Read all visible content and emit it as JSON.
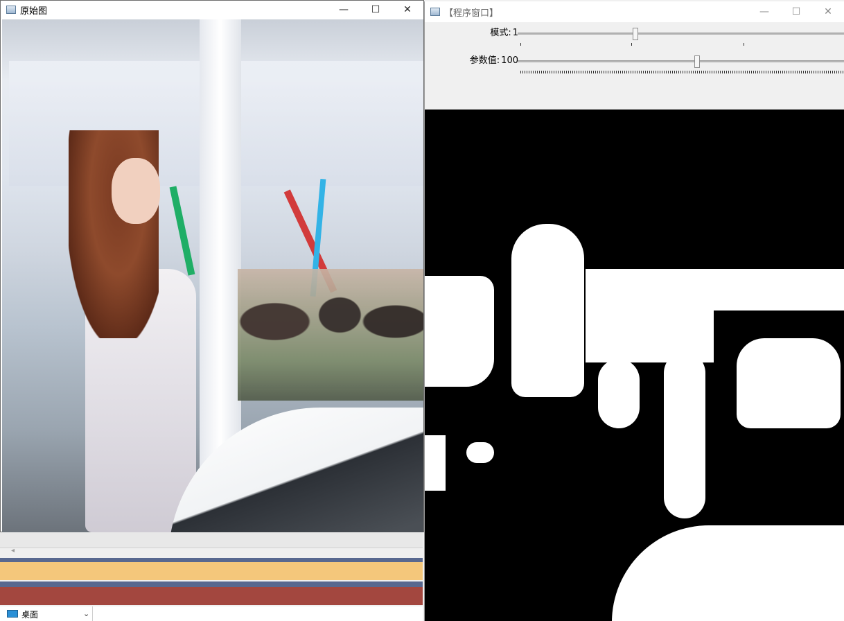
{
  "left_window": {
    "title": "原始图",
    "icon": "app-window-icon",
    "buttons": {
      "minimize": "—",
      "maximize": "☐",
      "close": "✕"
    }
  },
  "right_window": {
    "title": "【程序窗口】",
    "icon": "app-window-icon",
    "buttons": {
      "minimize": "—",
      "maximize": "☐",
      "close": "✕"
    },
    "trackbars": [
      {
        "label": "模式",
        "value": "1",
        "position_fraction": 0.36
      },
      {
        "label": "参数值",
        "value": "100",
        "position_fraction": 0.55
      }
    ]
  },
  "bottom": {
    "scroll_arrow": "◂",
    "desktop_label": "桌面",
    "chevron": "⌄"
  },
  "colors": {
    "band_blue": "#58688f",
    "band_orange": "#f4c77b",
    "band_red": "#a3473f",
    "thresholded_foreground": "#ffffff",
    "thresholded_background": "#000000"
  }
}
